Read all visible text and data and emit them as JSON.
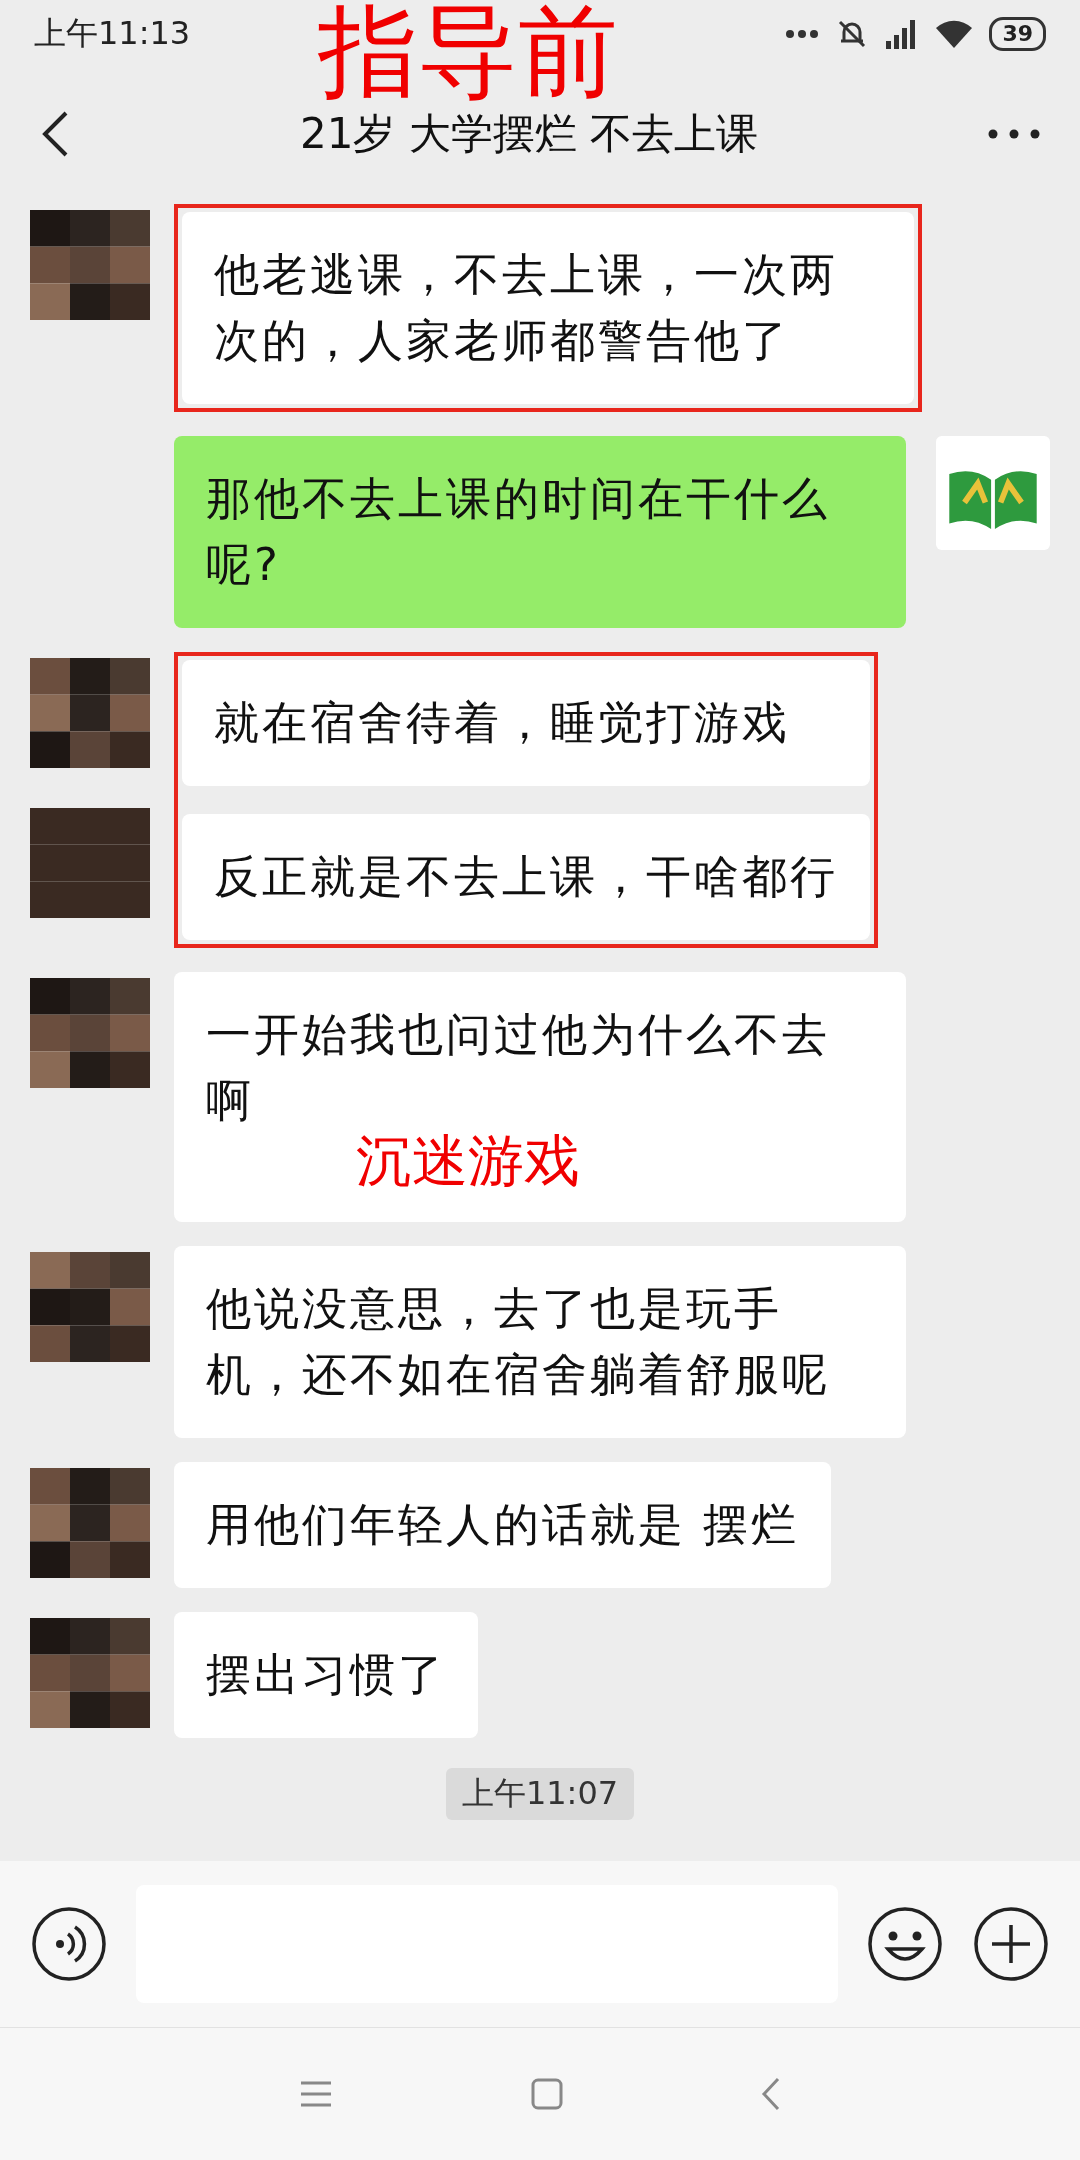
{
  "status_bar": {
    "time": "上午11:13",
    "battery": "39"
  },
  "annotation": "指导前",
  "header": {
    "title": "21岁 大学摆烂 不去上课"
  },
  "messages": [
    {
      "kind": "highlight",
      "messages": [
        {
          "text": "他老逃课，不去上课，一次两次的，人家老师都警告他了"
        }
      ]
    },
    {
      "kind": "sent",
      "text": "那他不去上课的时间在干什么呢?"
    },
    {
      "kind": "highlight",
      "messages": [
        {
          "text": "就在宿舍待着，睡觉打游戏"
        },
        {
          "text": "反正就是不去上课，干啥都行"
        }
      ]
    },
    {
      "kind": "received",
      "text": "一开始我也问过他为什么不去啊",
      "note": "沉迷游戏"
    },
    {
      "kind": "received",
      "text": "他说没意思，去了也是玩手机，还不如在宿舍躺着舒服呢"
    },
    {
      "kind": "received",
      "text": "用他们年轻人的话就是 摆烂"
    },
    {
      "kind": "received",
      "text": "摆出习惯了"
    }
  ],
  "timestamp": "上午11:07"
}
